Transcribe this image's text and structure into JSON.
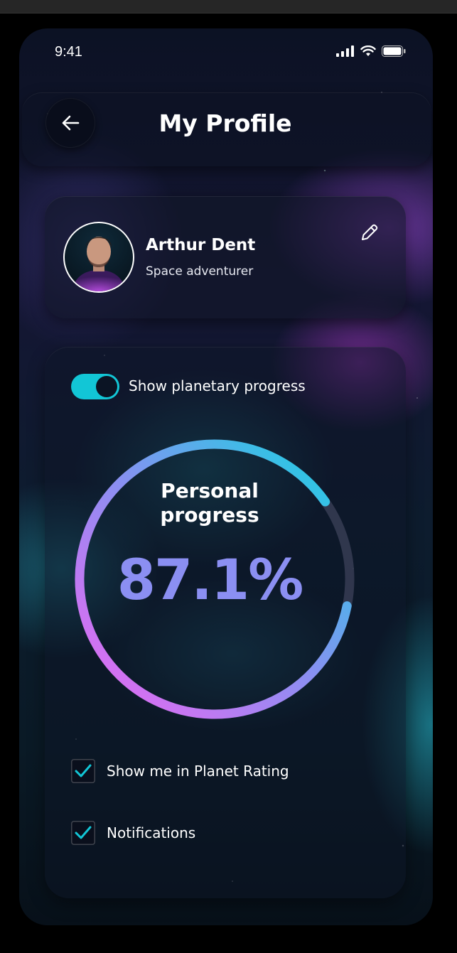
{
  "status_bar": {
    "time": "9:41"
  },
  "header": {
    "title": "My Profile"
  },
  "profile": {
    "name": "Arthur Dent",
    "subtitle": "Space adventurer"
  },
  "progress": {
    "toggle_label": "Show planetary progress",
    "toggle_on": true,
    "title_line1": "Personal",
    "title_line2": "progress",
    "value_text": "87.1%",
    "value": 0.871
  },
  "options": [
    {
      "label": "Show me in Planet Rating",
      "checked": true
    },
    {
      "label": "Notifications",
      "checked": true
    }
  ],
  "colors": {
    "accent_cyan": "#12c6d6",
    "accent_violet": "#8b8ff2",
    "accent_magenta": "#e070f0"
  },
  "icons": {
    "back": "arrow-left-icon",
    "edit": "pencil-icon",
    "signal": "signal-bars-icon",
    "wifi": "wifi-icon",
    "battery": "battery-icon",
    "check": "checkmark-icon"
  }
}
